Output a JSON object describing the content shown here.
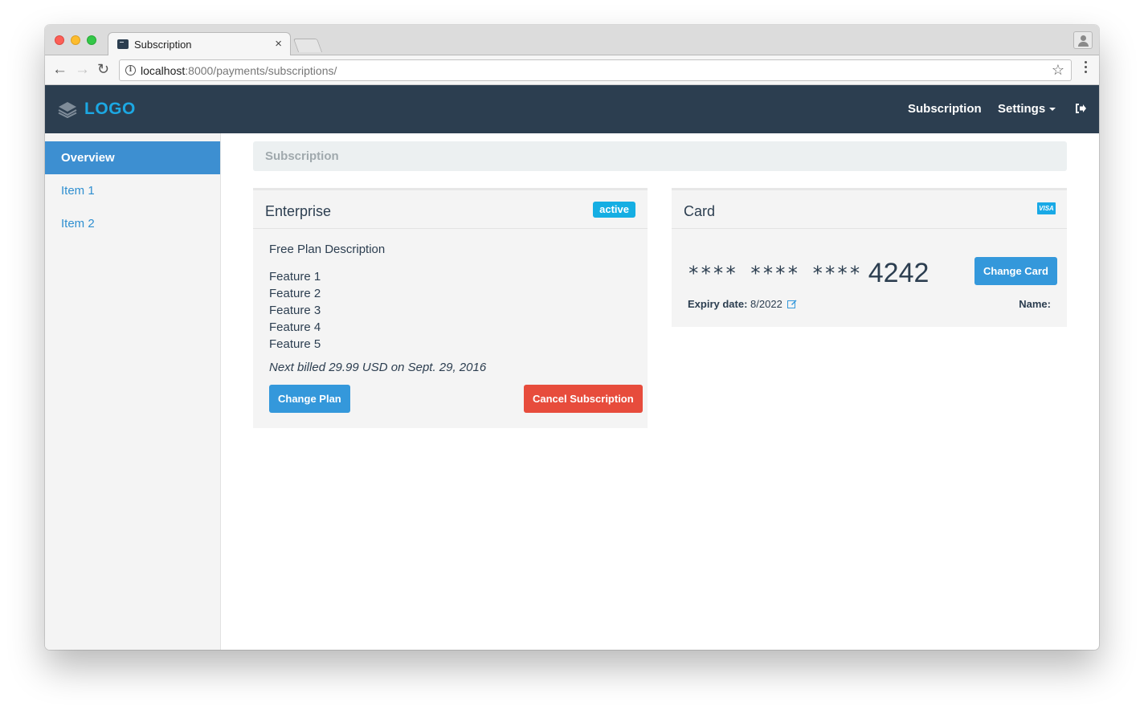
{
  "browser": {
    "tab_title": "Subscription",
    "tab_close": "×",
    "url_host": "localhost",
    "url_rest": ":8000/payments/subscriptions/",
    "info_glyph": "i",
    "back_glyph": "←",
    "forward_glyph": "→",
    "reload_glyph": "↻",
    "star_glyph": "☆"
  },
  "navbar": {
    "logo": "LOGO",
    "links": {
      "subscription": "Subscription",
      "settings": "Settings"
    },
    "colors": {
      "background": "#2c3e50",
      "logo": "#1ca8e3"
    }
  },
  "sidebar": {
    "items": [
      {
        "label": "Overview",
        "active": true
      },
      {
        "label": "Item 1",
        "active": false
      },
      {
        "label": "Item 2",
        "active": false
      }
    ]
  },
  "breadcrumb": {
    "label": "Subscription"
  },
  "plan": {
    "title": "Enterprise",
    "status": "active",
    "description": "Free Plan Description",
    "features": [
      "Feature 1",
      "Feature 2",
      "Feature 3",
      "Feature 4",
      "Feature 5"
    ],
    "next_billed": "Next billed 29.99 USD on Sept. 29, 2016",
    "change_label": "Change Plan",
    "cancel_label": "Cancel Subscription"
  },
  "card": {
    "title": "Card",
    "brand": "VISA",
    "masked": "**** **** ****",
    "last4": "4242",
    "change_label": "Change Card",
    "expiry_label": "Expiry date:",
    "expiry_value": "8/2022",
    "name_label": "Name:"
  },
  "colors": {
    "primary": "#3498db",
    "danger": "#e74c3c",
    "badge": "#15aee3",
    "sidebar_active": "#3d8fd1"
  },
  "icons": [
    "info-icon",
    "star-icon",
    "menu-icon",
    "logo-icon",
    "logout-icon",
    "visa-icon",
    "edit-icon",
    "profile-icon"
  ]
}
